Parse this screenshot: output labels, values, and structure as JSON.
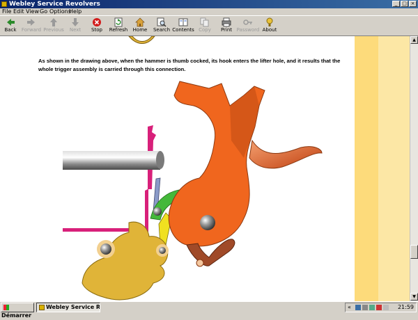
{
  "window": {
    "title": "Webley Service Revolvers"
  },
  "window_controls": {
    "minimize": "_",
    "maximize": "□",
    "close": "×"
  },
  "menu": [
    "File",
    "Edit",
    "View",
    "Go",
    "Options",
    "Help"
  ],
  "toolbar": [
    {
      "label": "Back",
      "icon": "back-arrow-icon",
      "enabled": true
    },
    {
      "label": "Forward",
      "icon": "forward-arrow-icon",
      "enabled": false
    },
    {
      "label": "Previous",
      "icon": "up-arrow-icon",
      "enabled": false
    },
    {
      "label": "Next",
      "icon": "down-arrow-icon",
      "enabled": false
    },
    {
      "label": "Stop",
      "icon": "stop-icon",
      "enabled": true
    },
    {
      "label": "Refresh",
      "icon": "refresh-icon",
      "enabled": true
    },
    {
      "label": "Home",
      "icon": "home-icon",
      "enabled": true
    },
    {
      "label": "Search",
      "icon": "search-icon",
      "enabled": true
    },
    {
      "label": "Contents",
      "icon": "contents-icon",
      "enabled": true
    },
    {
      "label": "Copy",
      "icon": "copy-icon",
      "enabled": false
    },
    {
      "label": "Print",
      "icon": "print-icon",
      "enabled": true
    },
    {
      "label": "Password",
      "icon": "key-icon",
      "enabled": false
    },
    {
      "label": "About",
      "icon": "about-icon",
      "enabled": true
    }
  ],
  "content": {
    "paragraph": "As shown in the drawing above, when the hammer is thumb cocked, its hook enters the lifter hole, and it results that the whole trigger assembly is carried through this connection."
  },
  "colors": {
    "hammer": "#f0661e",
    "lifter": "#e0b438",
    "frame_bar": "#d8207a",
    "pawl": "#44b83a",
    "barrel": "#9a9a9a",
    "stripe_dark": "#fddb7b",
    "stripe_light": "#fce7a5"
  },
  "taskbar": {
    "start": "Démarrer",
    "task": "Webley Service Revol...",
    "clock": "21:59",
    "tray_arrow": "«"
  }
}
